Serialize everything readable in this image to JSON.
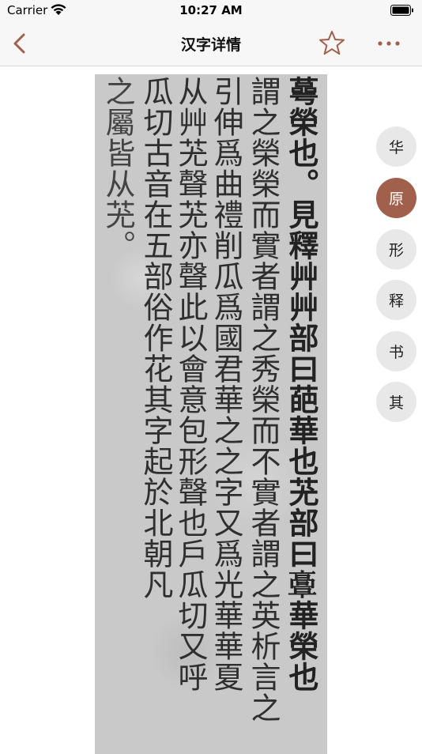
{
  "status_bar": {
    "carrier": "Carrier",
    "time": "10:27 AM"
  },
  "nav": {
    "title": "汉字详情"
  },
  "scan_text": {
    "columns": [
      "蕚榮也。見釋艸艸部曰葩華也𦬓部曰𩫏華榮也",
      "謂之榮榮而實者謂之秀榮而不實者謂之英析言之",
      "引伸爲曲禮削瓜爲國君華之之字又爲光華華夏",
      "从艸𦬓聲𦬓亦聲此以會意包形聲也戶瓜切又呼",
      "瓜切古音在五部俗作花其字起於北朝凡",
      "之屬皆从𦬓。"
    ]
  },
  "side_menu": {
    "items": [
      {
        "label": "华",
        "active": false
      },
      {
        "label": "原",
        "active": true
      },
      {
        "label": "形",
        "active": false
      },
      {
        "label": "释",
        "active": false
      },
      {
        "label": "书",
        "active": false
      },
      {
        "label": "其",
        "active": false
      }
    ]
  },
  "colors": {
    "accent": "#a0604b",
    "star": "#a0604b",
    "side_button_bg": "#e8e8e8"
  }
}
